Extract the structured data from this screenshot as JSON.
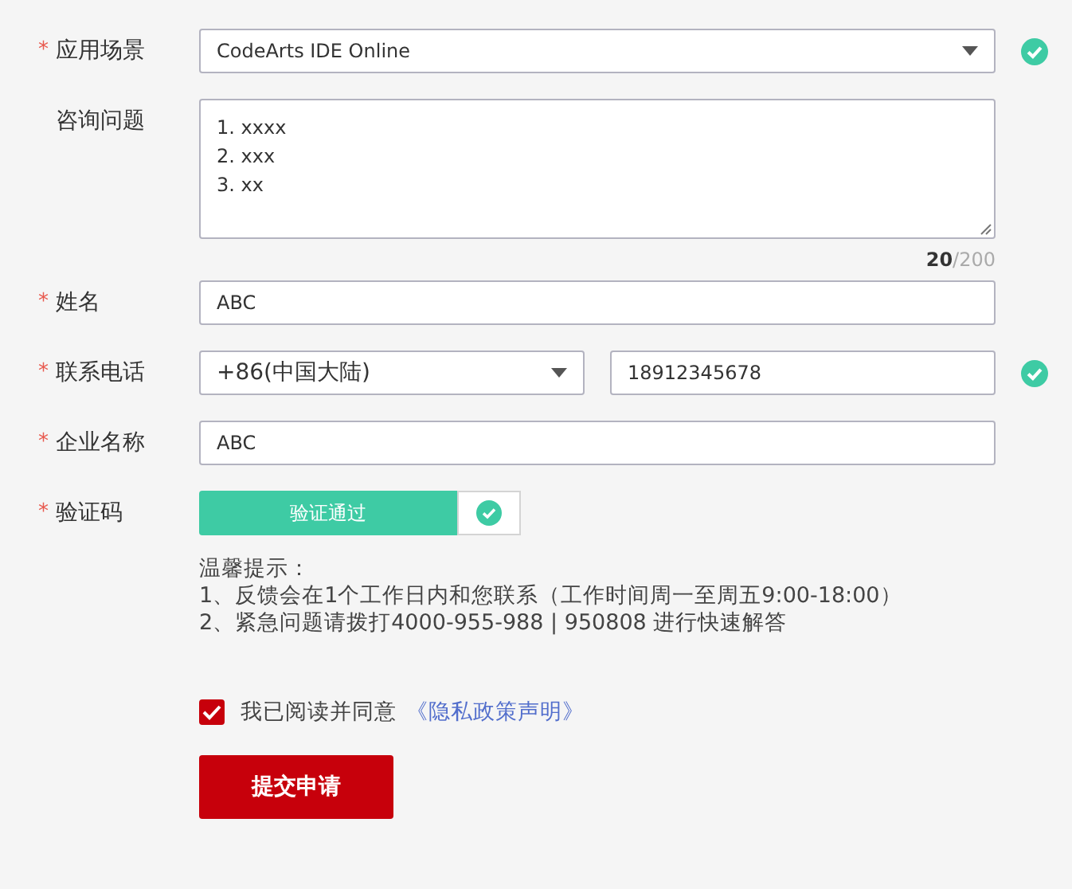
{
  "fields": [
    {
      "kind": "select",
      "mark": "*",
      "label": "应用场景",
      "value": "CodeArts IDE Online",
      "valid": true
    },
    {
      "kind": "textarea",
      "label": "咨询问题",
      "value": "1. xxxx\n2. xxx\n3. xx",
      "count": "20",
      "max": "/200"
    },
    {
      "kind": "text",
      "mark": "*",
      "label": "姓名",
      "value": "ABC",
      "valid": false
    },
    {
      "kind": "phone",
      "mark": "*",
      "label": "联系电话",
      "code": "+86(中国大陆)",
      "value": "18912345678",
      "valid": true
    },
    {
      "kind": "text",
      "mark": "*",
      "label": "企业名称",
      "value": "ABC",
      "valid": false
    },
    {
      "kind": "captcha",
      "mark": "*",
      "label": "验证码",
      "status": "验证通过",
      "verified": true
    }
  ],
  "tips": {
    "title": "温馨提示：",
    "lines": [
      "1、反馈会在1个工作日内和您联系（工作时间周一至周五9:00-18:00）",
      "2、紧急问题请拨打4000-955-988 | 950808 进行快速解答"
    ]
  },
  "agreement": {
    "checked": true,
    "text": "我已阅读并同意",
    "link": "《隐私政策声明》"
  },
  "submit_button": "提交申请"
}
